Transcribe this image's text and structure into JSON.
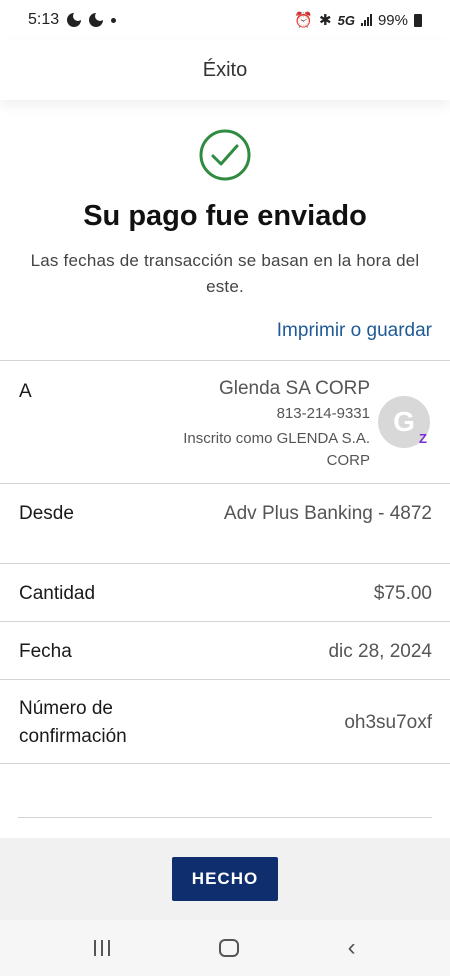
{
  "status_bar": {
    "time": "5:13",
    "network": "5G",
    "battery": "99%"
  },
  "header": {
    "title": "Éxito"
  },
  "confirmation": {
    "title": "Su pago fue enviado",
    "subtitle": "Las fechas de transacción se basan en la hora del este.",
    "print_link": "Imprimir o guardar",
    "accent_color": "#2e8b3f"
  },
  "details": {
    "to": {
      "label": "A",
      "name": "Glenda SA CORP",
      "phone": "813-214-9331",
      "enrolled": "Inscrito como GLENDA S.A. CORP",
      "avatar_initial": "G",
      "badge_icon": "zelle-icon"
    },
    "from": {
      "label": "Desde",
      "value": "Adv Plus Banking - 4872"
    },
    "amount": {
      "label": "Cantidad",
      "value": "$75.00"
    },
    "date": {
      "label": "Fecha",
      "value": "dic 28, 2024"
    },
    "confirmation_number": {
      "label": "Número de confirmación",
      "value": "oh3su7oxf"
    }
  },
  "footer": {
    "done_label": "HECHO",
    "button_color": "#0f2e6e"
  }
}
